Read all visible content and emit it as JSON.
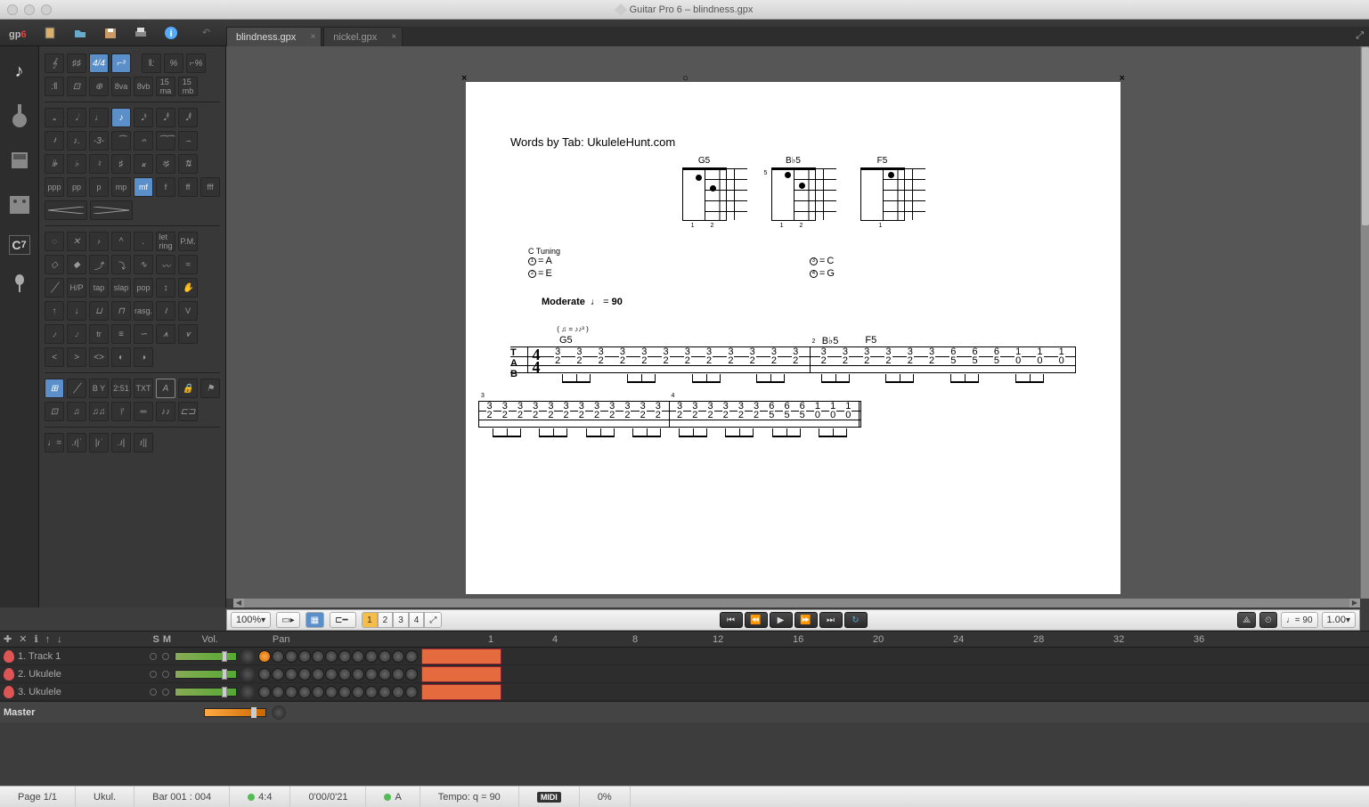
{
  "window": {
    "title": "Guitar Pro 6 – blindness.gpx"
  },
  "logo": {
    "gp": "gp",
    "six": "6"
  },
  "tabs": [
    {
      "name": "blindness.gpx",
      "active": true
    },
    {
      "name": "nickel.gpx",
      "active": false
    }
  ],
  "score": {
    "credit": "Words by Tab: UkuleleHunt.com",
    "chords": [
      {
        "name": "G5",
        "marks": [
          "×",
          "",
          "",
          "×"
        ],
        "fingering": "1  2"
      },
      {
        "name": "B♭5",
        "marks": [
          "×",
          "",
          "",
          "×"
        ],
        "fret_label": "5",
        "fingering": "1  2"
      },
      {
        "name": "F5",
        "marks": [
          "×",
          "○",
          "",
          "×"
        ],
        "fingering": "1"
      }
    ],
    "tuning": {
      "title": "C Tuning",
      "strings": [
        {
          "n": "1",
          "note": "A"
        },
        {
          "n": "3",
          "note": "C"
        },
        {
          "n": "2",
          "note": "E"
        },
        {
          "n": "4",
          "note": "G"
        }
      ]
    },
    "tempo": {
      "label": "Moderate",
      "mark": "♩",
      "bpm": 90
    },
    "swing": "( ♫ = ♪♪³ )",
    "time_sig": {
      "top": "4",
      "bot": "4"
    },
    "tab_label": [
      "T",
      "A",
      "B"
    ],
    "line1": {
      "chords": [
        "G5",
        "B♭5",
        "F5"
      ],
      "bars": [
        {
          "num": "",
          "cols": [
            [
              "3",
              "2"
            ],
            [
              "3",
              "2"
            ],
            [
              "3",
              "2"
            ],
            [
              "3",
              "2"
            ],
            [
              "3",
              "2"
            ],
            [
              "3",
              "2"
            ],
            [
              "3",
              "2"
            ],
            [
              "3",
              "2"
            ],
            [
              "3",
              "2"
            ],
            [
              "3",
              "2"
            ],
            [
              "3",
              "2"
            ],
            [
              "3",
              "2"
            ]
          ]
        },
        {
          "num": "2",
          "cols": [
            [
              "3",
              "2"
            ],
            [
              "3",
              "2"
            ],
            [
              "3",
              "2"
            ],
            [
              "3",
              "2"
            ],
            [
              "3",
              "2"
            ],
            [
              "3",
              "2"
            ],
            [
              "6",
              "5"
            ],
            [
              "6",
              "5"
            ],
            [
              "6",
              "5"
            ],
            [
              "1",
              "0"
            ],
            [
              "1",
              "0"
            ],
            [
              "1",
              "0"
            ]
          ]
        }
      ]
    },
    "line2": {
      "bars": [
        {
          "num": "3",
          "cols": [
            [
              "3",
              "2"
            ],
            [
              "3",
              "2"
            ],
            [
              "3",
              "2"
            ],
            [
              "3",
              "2"
            ],
            [
              "3",
              "2"
            ],
            [
              "3",
              "2"
            ],
            [
              "3",
              "2"
            ],
            [
              "3",
              "2"
            ],
            [
              "3",
              "2"
            ],
            [
              "3",
              "2"
            ],
            [
              "3",
              "2"
            ],
            [
              "3",
              "2"
            ]
          ]
        },
        {
          "num": "4",
          "cols": [
            [
              "3",
              "2"
            ],
            [
              "3",
              "2"
            ],
            [
              "3",
              "2"
            ],
            [
              "3",
              "2"
            ],
            [
              "3",
              "2"
            ],
            [
              "3",
              "2"
            ],
            [
              "6",
              "5"
            ],
            [
              "6",
              "5"
            ],
            [
              "6",
              "5"
            ],
            [
              "1",
              "0"
            ],
            [
              "1",
              "0"
            ],
            [
              "1",
              "0"
            ]
          ],
          "end": true
        }
      ]
    }
  },
  "controls": {
    "zoom": "100%",
    "voices": [
      "1",
      "2",
      "3",
      "4"
    ],
    "tempo_disp": "♩= 90",
    "speed": "1.00"
  },
  "ruler": [
    {
      "pos": 2,
      "label": "1"
    },
    {
      "pos": 74,
      "label": "4"
    },
    {
      "pos": 164,
      "label": "8"
    },
    {
      "pos": 254,
      "label": "12"
    },
    {
      "pos": 344,
      "label": "16"
    },
    {
      "pos": 434,
      "label": "20"
    },
    {
      "pos": 524,
      "label": "24"
    },
    {
      "pos": 614,
      "label": "28"
    },
    {
      "pos": 704,
      "label": "32"
    },
    {
      "pos": 794,
      "label": "36"
    }
  ],
  "track_header": {
    "vol": "Vol.",
    "pan": "Pan",
    "s": "S",
    "m": "M"
  },
  "tracks": [
    {
      "name": "1. Track 1",
      "block_start": 0,
      "block_width": 90,
      "solo": false,
      "mute": false
    },
    {
      "name": "2. Ukulele",
      "block_start": 0,
      "block_width": 90
    },
    {
      "name": "3. Ukulele",
      "block_start": 0,
      "block_width": 90
    }
  ],
  "master": {
    "label": "Master"
  },
  "status": {
    "page": "Page 1/1",
    "instrument": "Ukul.",
    "bar": "Bar 001 : 004",
    "ts": "4:4",
    "time": "0'00/0'21",
    "key": "A",
    "tempo": "Tempo: q = 90",
    "midi": "MIDI",
    "pct": "0%"
  }
}
